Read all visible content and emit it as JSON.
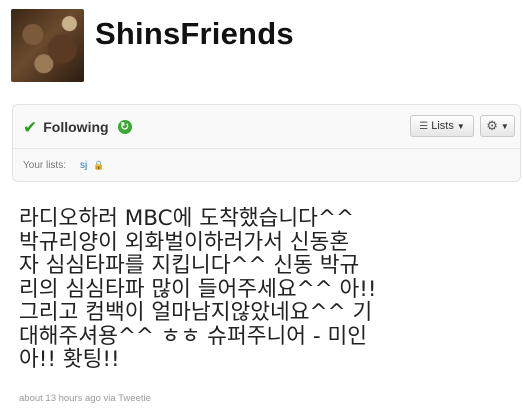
{
  "profile": {
    "screen_name": "ShinsFriends"
  },
  "follow_panel": {
    "following_label": "Following",
    "lists_button_label": "Lists",
    "your_lists_label": "Your lists:",
    "list_name": "sj"
  },
  "icons": {
    "following": "checkmark-icon",
    "refresh": "refresh-icon",
    "lists": "lists-icon",
    "settings": "gear-icon",
    "private_list": "lock-icon"
  },
  "colors": {
    "accent_green": "#2e9c1f",
    "link_blue": "#2276bb"
  },
  "tweet": {
    "lines": [
      "라디오하러 MBC에 도착했습니다^^",
      "박규리양이 외화벌이하러가서 신동혼",
      "자 심심타파를 지킵니다^^ 신동 박규",
      "리의 심심타파 많이 들어주세요^^ 아!!",
      "그리고 컴백이 얼마남지않았네요^^ 기",
      "대해주셔용^^ ㅎㅎ 슈퍼주니어 - 미인",
      "아!! 홧팅!!"
    ],
    "timestamp": "about 13 hours ago",
    "via_label": "via",
    "source": "Tweetie"
  }
}
